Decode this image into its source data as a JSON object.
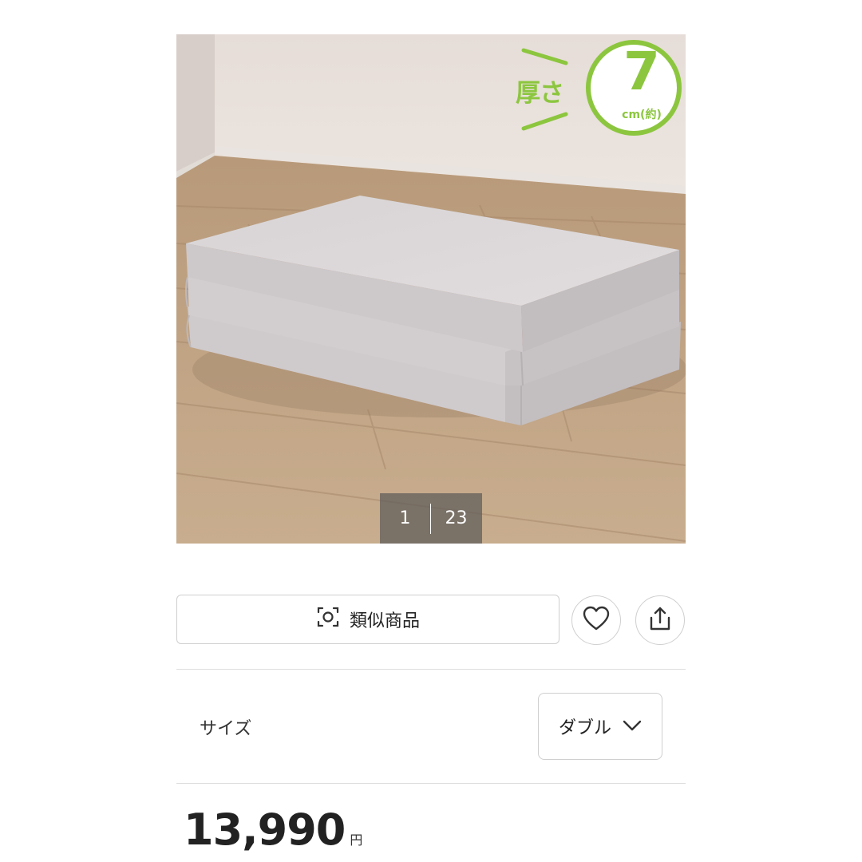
{
  "product_image": {
    "badge": {
      "label": "厚さ",
      "value": "7",
      "unit": "cm(約)",
      "color": "#8cc63f"
    },
    "counter": {
      "current": "1",
      "total": "23"
    }
  },
  "actions": {
    "similar_label": "類似商品",
    "similar_icon": "image-search-icon",
    "like_icon": "heart-icon",
    "share_icon": "share-icon"
  },
  "size": {
    "label": "サイズ",
    "selected": "ダブル",
    "icon": "chevron-down-icon"
  },
  "price": {
    "value": "13,990",
    "unit": "円"
  }
}
